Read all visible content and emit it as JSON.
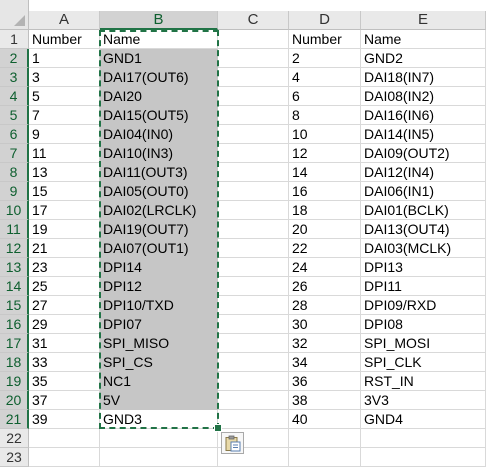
{
  "columns": [
    "A",
    "B",
    "C",
    "D",
    "E"
  ],
  "selected_column": "B",
  "row_numbers": [
    "1",
    "2",
    "3",
    "4",
    "5",
    "6",
    "7",
    "8",
    "9",
    "10",
    "11",
    "12",
    "13",
    "14",
    "15",
    "16",
    "17",
    "18",
    "19",
    "20",
    "21",
    "22",
    "23"
  ],
  "rows": [
    [
      "Number",
      "Name",
      "",
      "Number",
      "Name"
    ],
    [
      "1",
      "GND1",
      "",
      "2",
      "GND2"
    ],
    [
      "3",
      "DAI17(OUT6)",
      "",
      "4",
      "DAI18(IN7)"
    ],
    [
      "5",
      "DAI20",
      "",
      "6",
      "DAI08(IN2)"
    ],
    [
      "7",
      "DAI15(OUT5)",
      "",
      "8",
      "DAI16(IN6)"
    ],
    [
      "9",
      "DAI04(IN0)",
      "",
      "10",
      "DAI14(IN5)"
    ],
    [
      "11",
      "DAI10(IN3)",
      "",
      "12",
      "DAI09(OUT2)"
    ],
    [
      "13",
      "DAI11(OUT3)",
      "",
      "14",
      "DAI12(IN4)"
    ],
    [
      "15",
      "DAI05(OUT0)",
      "",
      "16",
      "DAI06(IN1)"
    ],
    [
      "17",
      "DAI02(LRCLK)",
      "",
      "18",
      "DAI01(BCLK)"
    ],
    [
      "19",
      "DAI19(OUT7)",
      "",
      "20",
      "DAI13(OUT4)"
    ],
    [
      "21",
      "DAI07(OUT1)",
      "",
      "22",
      "DAI03(MCLK)"
    ],
    [
      "23",
      "DPI14",
      "",
      "24",
      "DPI13"
    ],
    [
      "25",
      "DPI12",
      "",
      "26",
      "DPI11"
    ],
    [
      "27",
      "DPI10/TXD",
      "",
      "28",
      "DPI09/RXD"
    ],
    [
      "29",
      "DPI07",
      "",
      "30",
      "DPI08"
    ],
    [
      "31",
      "SPI_MISO",
      "",
      "32",
      "SPI_MOSI"
    ],
    [
      "33",
      "SPI_CS",
      "",
      "34",
      "SPI_CLK"
    ],
    [
      "35",
      "NC1",
      "",
      "36",
      "RST_IN"
    ],
    [
      "37",
      "5V",
      "",
      "38",
      "3V3"
    ],
    [
      "39",
      "GND3",
      "",
      "40",
      "GND4"
    ],
    [
      "",
      "",
      "",
      "",
      ""
    ],
    [
      "",
      "",
      "",
      "",
      ""
    ]
  ],
  "highlighted_rows_in_selection": 19,
  "colors": {
    "selection_border": "#217346",
    "selection_fill": "#c6c6c6",
    "header_bg": "#e9e9e9",
    "selected_header_bg": "#d2d2d2"
  },
  "icons": {
    "paste_options": "clipboard-icon",
    "select_all": "select-all-triangle-icon"
  }
}
